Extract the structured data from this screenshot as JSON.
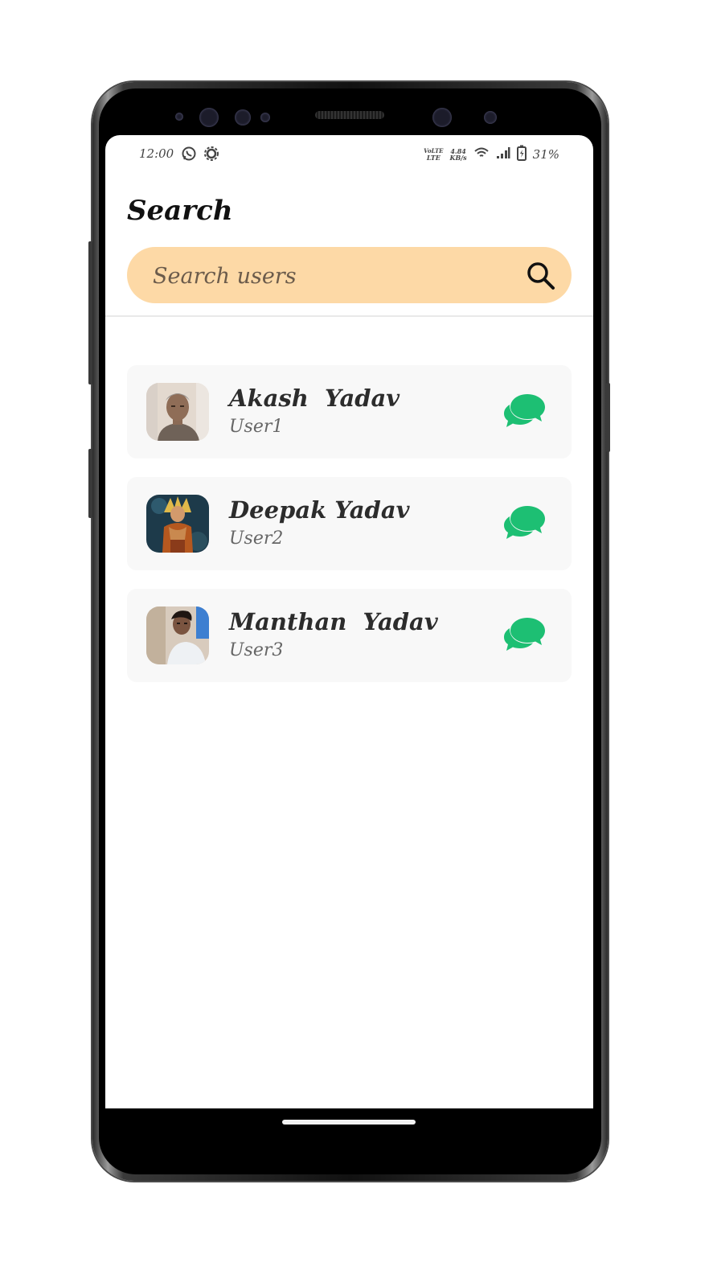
{
  "status_bar": {
    "time": "12:00",
    "network_label_top": "VoLTE",
    "network_label_bottom": "LTE",
    "speed_value": "4.84",
    "speed_unit": "KB/s",
    "battery": "31%"
  },
  "header": {
    "title": "Search"
  },
  "search": {
    "placeholder": "Search users",
    "value": ""
  },
  "users": [
    {
      "name": "Akash  Yadav",
      "subtitle": "User1"
    },
    {
      "name": "Deepak Yadav",
      "subtitle": "User2"
    },
    {
      "name": "Manthan  Yadav",
      "subtitle": "User3"
    }
  ],
  "colors": {
    "search_bg": "#fdd9a6",
    "chat_accent": "#1dbf73",
    "card_bg": "#f8f8f8"
  },
  "icons": [
    "whatsapp-icon",
    "settings-icon",
    "wifi-icon",
    "signal-icon",
    "battery-icon",
    "search-icon",
    "chat-icon"
  ]
}
